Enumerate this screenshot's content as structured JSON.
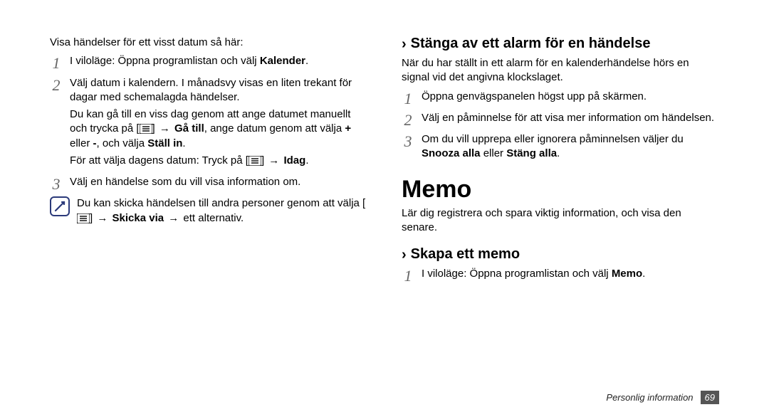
{
  "left": {
    "intro": "Visa händelser för ett visst datum så här:",
    "steps": [
      {
        "num": "1",
        "line1_pre": "I viloläge: Öppna programlistan och välj ",
        "line1_bold": "Kalender",
        "line1_post": "."
      },
      {
        "num": "2",
        "line1": "Välj datum i kalendern. I månadsvy visas en liten trekant för dagar med schemalagda händelser.",
        "line2_pre": "Du kan gå till en viss dag genom att ange datumet manuellt och trycka på [",
        "line2_post_a": "] ",
        "line2_arrow": "→",
        "line2_bold_a": " Gå till",
        "line2_mid": ", ange datum genom att välja ",
        "line2_bold_b": "+",
        "line2_mid2": " eller ",
        "line2_bold_c": "-",
        "line2_mid3": ", och välja ",
        "line2_bold_d": "Ställ in",
        "line2_end": ".",
        "line3_pre": "För att välja dagens datum: Tryck på [",
        "line3_post_a": "] ",
        "line3_arrow": "→",
        "line3_bold": " Idag",
        "line3_end": "."
      },
      {
        "num": "3",
        "line1": "Välj en händelse som du vill visa information om."
      }
    ],
    "note_pre": "Du kan skicka händelsen till andra personer genom att välja [",
    "note_post_a": "] ",
    "note_arrow1": "→",
    "note_bold": " Skicka via",
    "note_arrow2": " → ",
    "note_tail": "ett alternativ."
  },
  "right": {
    "h_close": "Stänga av ett alarm för en händelse",
    "close_body": "När du har ställt in ett alarm för en kalenderhändelse hörs en signal vid det angivna klockslaget.",
    "steps": [
      {
        "num": "1",
        "line1": "Öppna genvägspanelen högst upp på skärmen."
      },
      {
        "num": "2",
        "line1": "Välj en påminnelse för att visa mer information om händelsen."
      },
      {
        "num": "3",
        "line1_pre": "Om du vill upprepa eller ignorera påminnelsen väljer du ",
        "bold_a": "Snooza alla",
        "mid": " eller ",
        "bold_b": "Stäng alla",
        "end": "."
      }
    ],
    "h_memo": "Memo",
    "memo_body": "Lär dig registrera och spara viktig information, och visa den senare.",
    "h_create": "Skapa ett memo",
    "create_steps": [
      {
        "num": "1",
        "line1_pre": "I viloläge: Öppna programlistan och välj ",
        "bold": "Memo",
        "end": "."
      }
    ]
  },
  "footer": {
    "label": "Personlig information",
    "page": "69"
  },
  "icons": {
    "chevron": "›",
    "arrow": "→"
  }
}
